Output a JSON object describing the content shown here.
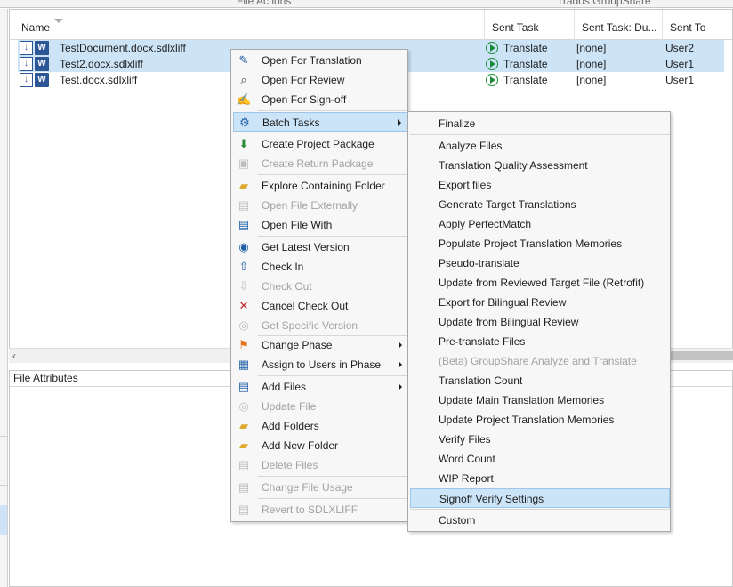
{
  "ribbon": {
    "groups": [
      "File Actions",
      "Trados GroupShare"
    ]
  },
  "grid": {
    "columns": [
      "Name",
      "Sent Task",
      "Sent Task: Du...",
      "Sent To"
    ],
    "rows": [
      {
        "name": "TestDocument.docx.sdlxliff",
        "sent_task": "Translate",
        "due": "[none]",
        "sent_to": "User2",
        "selected": true
      },
      {
        "name": "Test2.docx.sdlxliff",
        "sent_task": "Translate",
        "due": "[none]",
        "sent_to": "User1",
        "selected": true
      },
      {
        "name": "Test.docx.sdlxliff",
        "sent_task": "Translate",
        "due": "[none]",
        "sent_to": "User1",
        "selected": false
      }
    ]
  },
  "attributes_panel": {
    "title": "File Attributes"
  },
  "context_menu": {
    "items": [
      {
        "label": "Open For Translation",
        "icon": "pencil-icon",
        "enabled": true
      },
      {
        "label": "Open For Review",
        "icon": "magnifier-icon",
        "enabled": true
      },
      {
        "label": "Open For Sign-off",
        "icon": "signoff-icon",
        "enabled": true
      },
      {
        "label": "Batch Tasks",
        "icon": "batch-tasks-icon",
        "enabled": true,
        "submenu": true,
        "highlighted": true
      },
      {
        "label": "Create Project Package",
        "icon": "package-icon",
        "enabled": true
      },
      {
        "label": "Create Return Package",
        "icon": "return-package-icon",
        "enabled": false
      },
      {
        "label": "Explore Containing Folder",
        "icon": "folder-icon",
        "enabled": true
      },
      {
        "label": "Open File Externally",
        "icon": "file-external-icon",
        "enabled": false
      },
      {
        "label": "Open File With",
        "icon": "open-with-icon",
        "enabled": true
      },
      {
        "label": "Get Latest Version",
        "icon": "get-latest-icon",
        "enabled": true
      },
      {
        "label": "Check In",
        "icon": "check-in-icon",
        "enabled": true
      },
      {
        "label": "Check Out",
        "icon": "check-out-icon",
        "enabled": false
      },
      {
        "label": "Cancel Check Out",
        "icon": "cancel-checkout-icon",
        "enabled": true
      },
      {
        "label": "Get Specific Version",
        "icon": "specific-version-icon",
        "enabled": false
      },
      {
        "label": "Change Phase",
        "icon": "flag-icon",
        "enabled": true,
        "submenu": true
      },
      {
        "label": "Assign to Users in Phase",
        "icon": "calendar-icon",
        "enabled": true,
        "submenu": true
      },
      {
        "label": "Add Files",
        "icon": "add-files-icon",
        "enabled": true,
        "submenu": true
      },
      {
        "label": "Update File",
        "icon": "update-file-icon",
        "enabled": false
      },
      {
        "label": "Add Folders",
        "icon": "add-folders-icon",
        "enabled": true
      },
      {
        "label": "Add New Folder",
        "icon": "new-folder-icon",
        "enabled": true
      },
      {
        "label": "Delete Files",
        "icon": "delete-files-icon",
        "enabled": false
      },
      {
        "label": "Change File Usage",
        "icon": "file-usage-icon",
        "enabled": false
      },
      {
        "label": "Revert to SDLXLIFF",
        "icon": "revert-icon",
        "enabled": false
      }
    ]
  },
  "batch_submenu": {
    "items": [
      {
        "label": "Finalize",
        "enabled": true
      },
      {
        "label": "Analyze Files",
        "enabled": true
      },
      {
        "label": "Translation Quality Assessment",
        "enabled": true
      },
      {
        "label": "Export files",
        "enabled": true
      },
      {
        "label": "Generate Target Translations",
        "enabled": true
      },
      {
        "label": "Apply PerfectMatch",
        "enabled": true
      },
      {
        "label": "Populate Project Translation Memories",
        "enabled": true
      },
      {
        "label": "Pseudo-translate",
        "enabled": true
      },
      {
        "label": "Update from Reviewed Target File (Retrofit)",
        "enabled": true
      },
      {
        "label": "Export for Bilingual Review",
        "enabled": true
      },
      {
        "label": "Update from Bilingual Review",
        "enabled": true
      },
      {
        "label": "Pre-translate Files",
        "enabled": true
      },
      {
        "label": "(Beta) GroupShare Analyze and Translate",
        "enabled": false
      },
      {
        "label": "Translation Count",
        "enabled": true
      },
      {
        "label": "Update Main Translation Memories",
        "enabled": true
      },
      {
        "label": "Update Project Translation Memories",
        "enabled": true
      },
      {
        "label": "Verify Files",
        "enabled": true
      },
      {
        "label": "Word Count",
        "enabled": true
      },
      {
        "label": "WIP Report",
        "enabled": true
      },
      {
        "label": "Signoff Verify Settings",
        "enabled": true,
        "highlighted": true
      },
      {
        "label": "Custom",
        "enabled": true
      }
    ]
  },
  "colors": {
    "selection": "#cde4f7",
    "menu_highlight": "#cce4f7",
    "accent": "#2b5797",
    "task_green": "#1c8a3a"
  }
}
